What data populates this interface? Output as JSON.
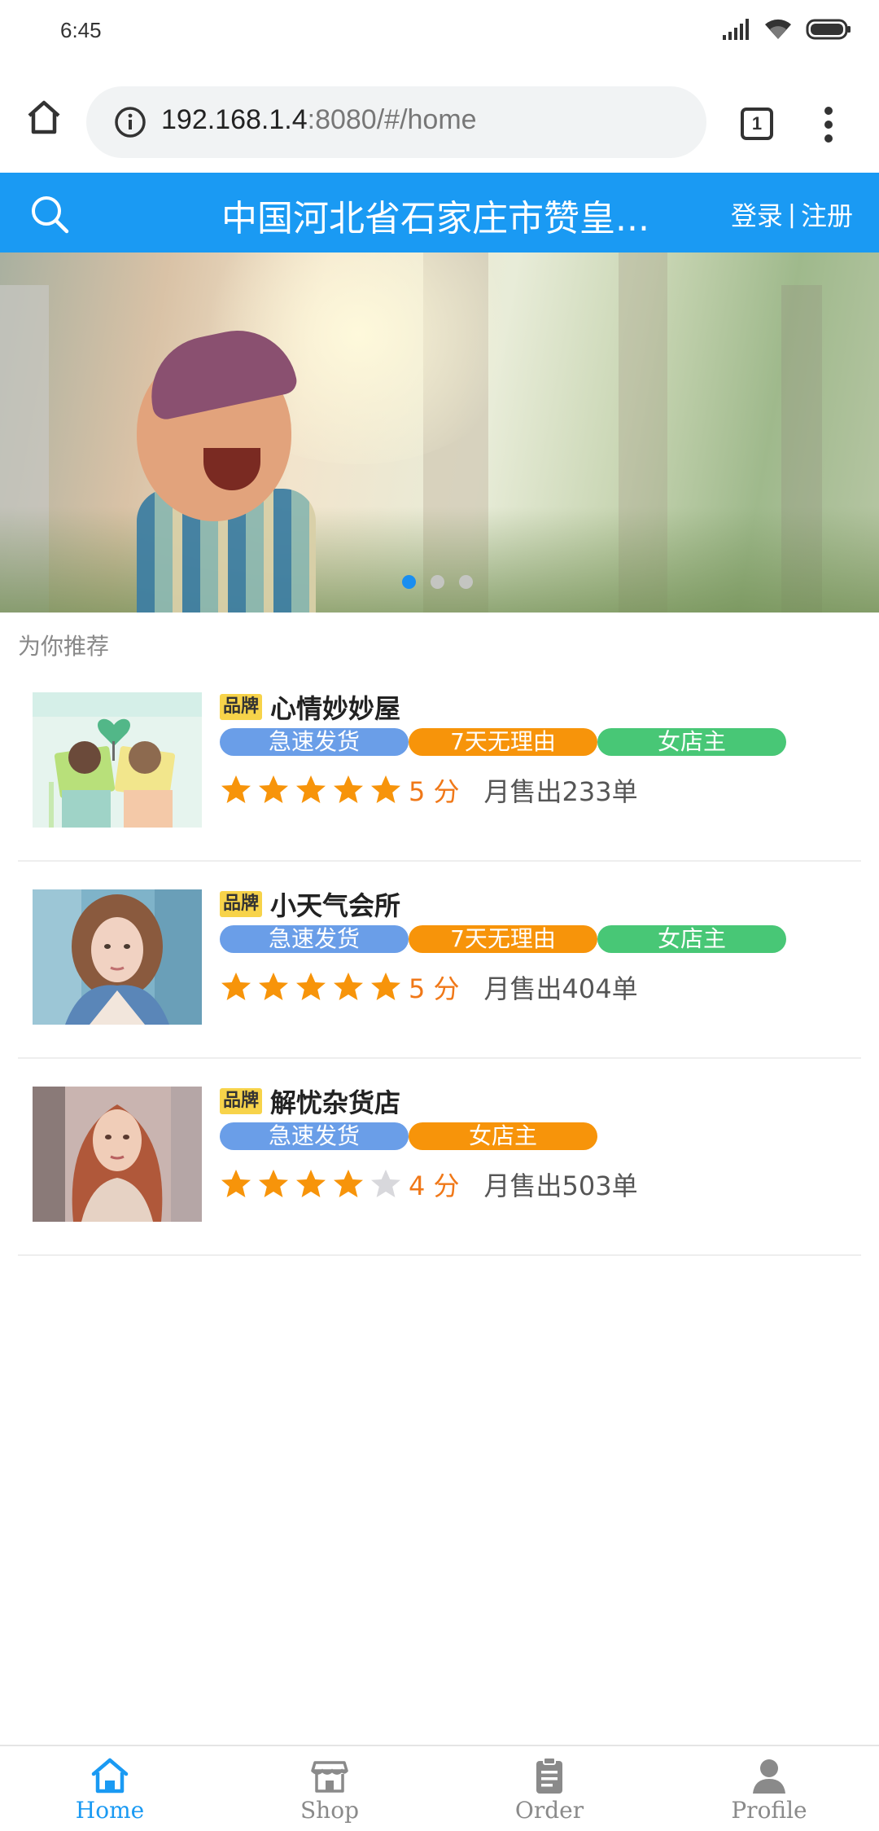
{
  "status_bar": {
    "time": "6:45",
    "icons": [
      "signal-icon",
      "wifi-icon",
      "battery-icon"
    ]
  },
  "browser": {
    "url_host": "192.168.1.4",
    "url_rest": ":8080/#/home",
    "tab_count": "1",
    "icons": [
      "home-icon",
      "info-icon",
      "menu-icon"
    ]
  },
  "header": {
    "title": "中国河北省石家庄市赞皇...",
    "login": "登录",
    "separator": "|",
    "register": "注册",
    "color": "#1a9af3"
  },
  "carousel": {
    "slide_count": 3,
    "active_index": 0
  },
  "section": {
    "title": "为你推荐"
  },
  "shops": [
    {
      "badge": "品牌",
      "name": "心情妙妙屋",
      "tags": [
        {
          "label": "急速发货",
          "color": "blue"
        },
        {
          "label": "7天无理由",
          "color": "orange"
        },
        {
          "label": "女店主",
          "color": "green"
        }
      ],
      "rating": 5,
      "score_text": "5 分",
      "monthly_sales": "月售出233单",
      "thumb": "illustrated-couple-image"
    },
    {
      "badge": "品牌",
      "name": "小天气会所",
      "tags": [
        {
          "label": "急速发货",
          "color": "blue"
        },
        {
          "label": "7天无理由",
          "color": "orange"
        },
        {
          "label": "女店主",
          "color": "green"
        }
      ],
      "rating": 5,
      "score_text": "5 分",
      "monthly_sales": "月售出404单",
      "thumb": "woman-denim-jacket-image"
    },
    {
      "badge": "品牌",
      "name": "解忧杂货店",
      "tags": [
        {
          "label": "急速发货",
          "color": "blue"
        },
        {
          "label": "女店主",
          "color": "orange"
        }
      ],
      "rating": 4,
      "score_text": "4 分",
      "monthly_sales": "月售出503单",
      "thumb": "woman-red-hair-image"
    }
  ],
  "tab_bar": {
    "tabs": [
      {
        "label": "Home",
        "icon": "home-icon",
        "active": true
      },
      {
        "label": "Shop",
        "icon": "shop-icon",
        "active": false
      },
      {
        "label": "Order",
        "icon": "clipboard-icon",
        "active": false
      },
      {
        "label": "Profile",
        "icon": "person-icon",
        "active": false
      }
    ]
  }
}
